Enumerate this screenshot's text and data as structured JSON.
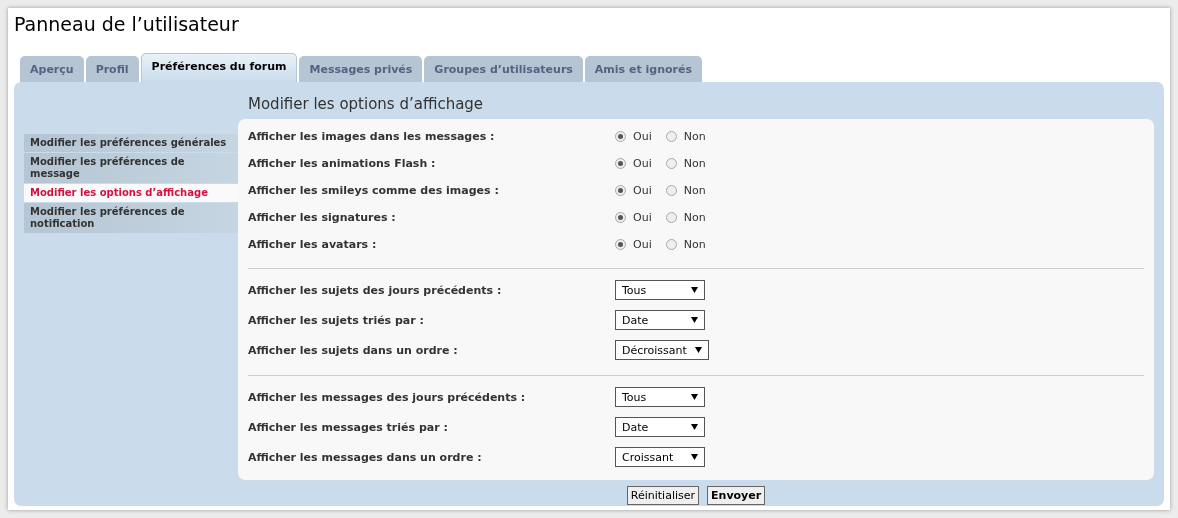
{
  "title": "Panneau de l’utilisateur",
  "tabs": [
    {
      "label": "Aperçu",
      "selected": false
    },
    {
      "label": "Profil",
      "selected": false
    },
    {
      "label": "Préférences du forum",
      "selected": true
    },
    {
      "label": "Messages privés",
      "selected": false
    },
    {
      "label": "Groupes d’utilisateurs",
      "selected": false
    },
    {
      "label": "Amis et ignorés",
      "selected": false
    }
  ],
  "sidebar": {
    "items": [
      {
        "label": "Modifier les préférences générales",
        "selected": false
      },
      {
        "label": "Modifier les préférences de message",
        "selected": false
      },
      {
        "label": "Modifier les options d’affichage",
        "selected": true
      },
      {
        "label": "Modifier les préférences de notification",
        "selected": false
      }
    ]
  },
  "heading": "Modifier les options d’affichage",
  "sections": [
    {
      "rows": [
        {
          "kind": "radio",
          "label": "Afficher les images dans les messages :",
          "options": [
            {
              "label": "Oui",
              "selected": true
            },
            {
              "label": "Non",
              "selected": false
            }
          ]
        },
        {
          "kind": "radio",
          "label": "Afficher les animations Flash :",
          "options": [
            {
              "label": "Oui",
              "selected": true
            },
            {
              "label": "Non",
              "selected": false
            }
          ]
        },
        {
          "kind": "radio",
          "label": "Afficher les smileys comme des images :",
          "options": [
            {
              "label": "Oui",
              "selected": true
            },
            {
              "label": "Non",
              "selected": false
            }
          ]
        },
        {
          "kind": "radio",
          "label": "Afficher les signatures :",
          "options": [
            {
              "label": "Oui",
              "selected": true
            },
            {
              "label": "Non",
              "selected": false
            }
          ]
        },
        {
          "kind": "radio",
          "label": "Afficher les avatars :",
          "options": [
            {
              "label": "Oui",
              "selected": true
            },
            {
              "label": "Non",
              "selected": false
            }
          ]
        }
      ]
    },
    {
      "rows": [
        {
          "kind": "select",
          "label": "Afficher les sujets des jours précédents :",
          "value": "Tous"
        },
        {
          "kind": "select",
          "label": "Afficher les sujets triés par :",
          "value": "Date"
        },
        {
          "kind": "select",
          "label": "Afficher les sujets dans un ordre :",
          "value": "Décroissant"
        }
      ]
    },
    {
      "rows": [
        {
          "kind": "select",
          "label": "Afficher les messages des jours précédents :",
          "value": "Tous"
        },
        {
          "kind": "select",
          "label": "Afficher les messages triés par :",
          "value": "Date"
        },
        {
          "kind": "select",
          "label": "Afficher les messages dans un ordre :",
          "value": "Croissant"
        }
      ]
    }
  ],
  "buttons": [
    "Réinitialiser",
    "Envoyer"
  ]
}
